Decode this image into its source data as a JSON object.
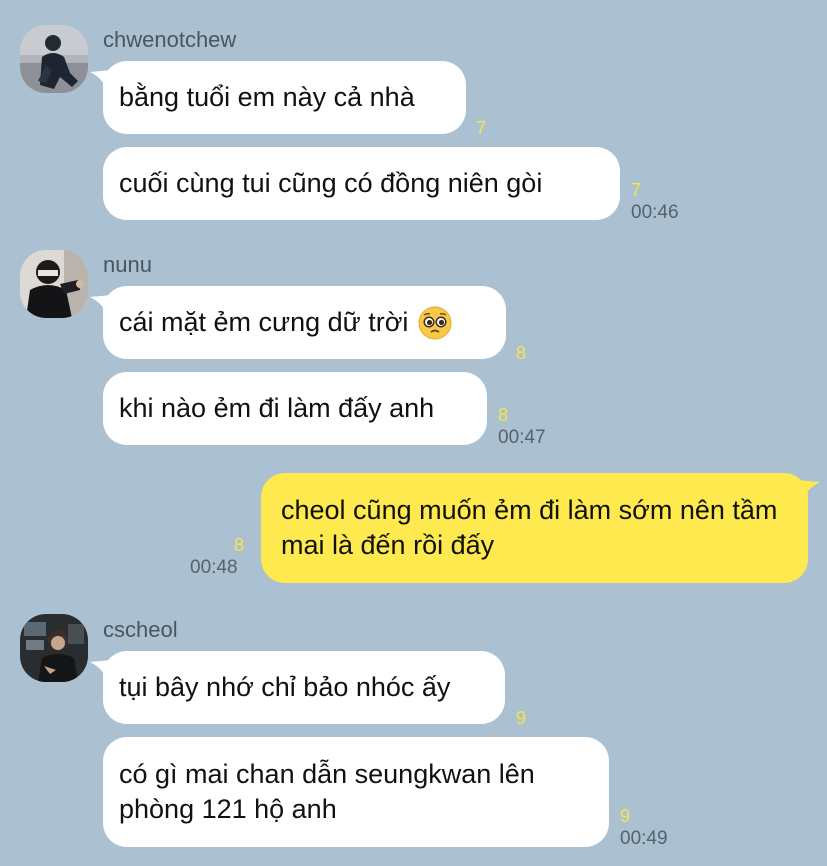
{
  "groups": [
    {
      "sender": "chwenotchew",
      "avatar_icon": "profile-photo",
      "messages": [
        {
          "text": "bằng tuổi em này cả nhà",
          "unread": "7",
          "time": ""
        },
        {
          "text": "cuối cùng tui cũng có đồng niên gòi",
          "unread": "7",
          "time": "00:46"
        }
      ]
    },
    {
      "sender": "nunu",
      "avatar_icon": "profile-photo",
      "messages": [
        {
          "text": "cái mặt ẻm cưng dữ trời",
          "emoji": "pleading-face-emoji",
          "unread": "8",
          "time": ""
        },
        {
          "text": "khi nào ẻm đi làm đấy anh",
          "unread": "8",
          "time": "00:47"
        }
      ]
    },
    {
      "sender": "",
      "mine": true,
      "messages": [
        {
          "text": "cheol cũng muốn ẻm đi làm sớm nên tầm mai là đến rồi đấy",
          "unread": "8",
          "time": "00:48"
        }
      ]
    },
    {
      "sender": "cscheol",
      "avatar_icon": "profile-photo",
      "messages": [
        {
          "text": "tụi bây nhớ chỉ bảo nhóc ấy",
          "unread": "9",
          "time": ""
        },
        {
          "text": "có gì mai chan dẫn seungkwan lên phòng 121 hộ anh",
          "unread": "9",
          "time": "00:49"
        }
      ]
    }
  ],
  "colors": {
    "background": "#abc1d1",
    "incoming_bubble": "#ffffff",
    "outgoing_bubble": "#fee94f",
    "unread_count": "#f4e54a",
    "timestamp": "#56626c"
  }
}
